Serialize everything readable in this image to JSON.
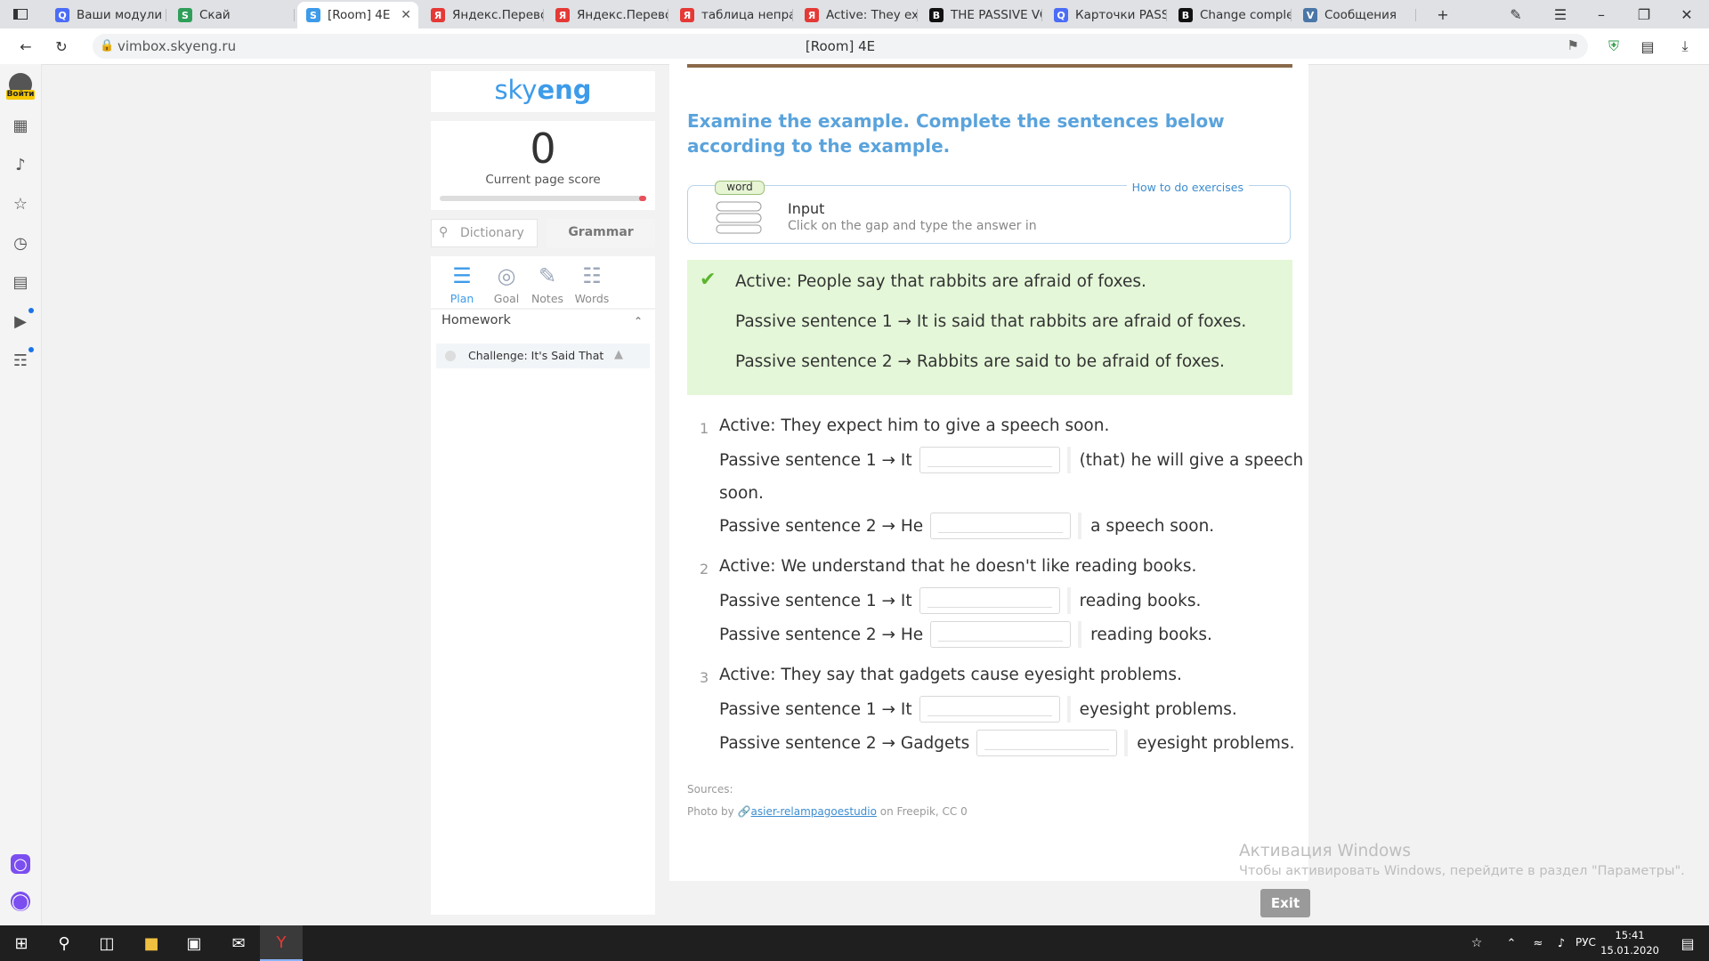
{
  "browser": {
    "tabs": [
      {
        "label": "Ваши модули | С",
        "fav": "Q",
        "color": "#4a6cf7"
      },
      {
        "label": "Скай",
        "fav": "S",
        "color": "#2f9e5a"
      },
      {
        "label": "[Room] 4E",
        "fav": "S",
        "color": "#3d9be9",
        "active": true
      },
      {
        "label": "Яндекс.Перевод",
        "fav": "Я",
        "color": "#e53935"
      },
      {
        "label": "Яндекс.Перевод",
        "fav": "Я",
        "color": "#e53935"
      },
      {
        "label": "таблица неправ",
        "fav": "Я",
        "color": "#e53935"
      },
      {
        "label": "Active: They expe",
        "fav": "Я",
        "color": "#e53935"
      },
      {
        "label": "THE PASSIVE VO",
        "fav": "B",
        "color": "#111111"
      },
      {
        "label": "Карточки PASSIV",
        "fav": "Q",
        "color": "#4a6cf7"
      },
      {
        "label": "Change complex",
        "fav": "B",
        "color": "#111111"
      },
      {
        "label": "Сообщения",
        "fav": "V",
        "color": "#4a76a8"
      }
    ],
    "address_domain": "vimbox.skyeng.ru",
    "page_title": "[Room] 4E"
  },
  "sidebar_rail": {
    "login_label": "Войти"
  },
  "left_panel": {
    "logo_sky": "sky",
    "logo_eng": "eng",
    "score": "0",
    "score_label": "Current page score",
    "dictionary_placeholder": "Dictionary",
    "grammar_label": "Grammar",
    "nav": [
      {
        "label": "Plan",
        "icon": "plan-icon"
      },
      {
        "label": "Goal",
        "icon": "goal-icon"
      },
      {
        "label": "Notes",
        "icon": "notes-icon"
      },
      {
        "label": "Words",
        "icon": "words-icon"
      }
    ],
    "homework_title": "Homework",
    "homework_item": "Challenge: It's Said That"
  },
  "exercise": {
    "question": "Examine the example. Complete the sentences below according to the example.",
    "how_to": "How to do exercises",
    "instr_badge": "word",
    "instr_title": "Input",
    "instr_desc": "Click on the gap and type the answer in",
    "example": [
      "Active: People say that rabbits are afraid of foxes.",
      "Passive sentence 1 → It is said that rabbits are afraid of foxes.",
      "Passive sentence 2 → Rabbits are said to be afraid of foxes."
    ],
    "items": [
      {
        "num": "1",
        "active": "Active: They expect him to give a speech soon.",
        "p1_pre": "Passive sentence 1 → It",
        "p1_post": "(that) he will give a speech",
        "p1_wrap": "soon.",
        "p2_pre": "Passive sentence 2 → He",
        "p2_post": "a speech soon."
      },
      {
        "num": "2",
        "active": "Active: We understand that he doesn't like reading books.",
        "p1_pre": "Passive sentence 1 → It",
        "p1_post": "reading books.",
        "p2_pre": "Passive sentence 2 → He",
        "p2_post": "reading books."
      },
      {
        "num": "3",
        "active": "Active: They say that gadgets cause eyesight problems.",
        "p1_pre": "Passive sentence 1 → It",
        "p1_post": "eyesight problems.",
        "p2_pre": "Passive sentence 2 → Gadgets",
        "p2_post": "eyesight problems."
      }
    ],
    "sources_label": "Sources:",
    "photo_prefix": "Photo by",
    "photo_author": "asier-relampagoestudio",
    "photo_suffix": "on Freepik, CC 0",
    "exit_label": "Exit"
  },
  "windows": {
    "watermark_title": "Активация Windows",
    "watermark_desc": "Чтобы активировать Windows, перейдите в раздел \"Параметры\".",
    "lang": "РУС",
    "time": "15:41",
    "date": "15.01.2020"
  }
}
